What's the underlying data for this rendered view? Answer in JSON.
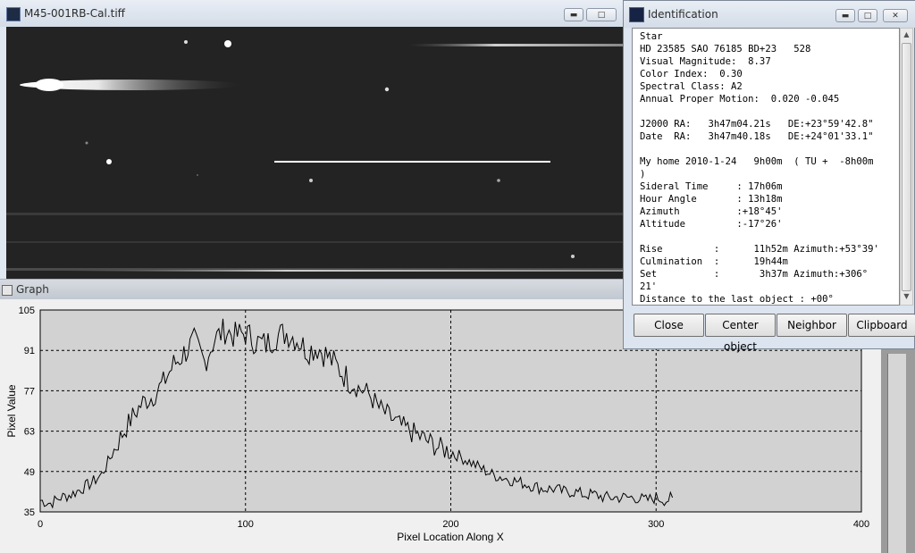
{
  "image_window": {
    "title": "M45-001RB-Cal.tiff",
    "controls": {
      "minimize_icon": "minimize-icon",
      "maximize_icon": "maximize-icon",
      "close_icon": "close-icon"
    }
  },
  "identification": {
    "title": "Identification",
    "lines": [
      "Star",
      "HD 23585 SAO 76185 BD+23   528",
      "Visual Magnitude:  8.37",
      "Color Index:  0.30",
      "Spectral Class: A2",
      "Annual Proper Motion:  0.020 -0.045",
      "",
      "J2000 RA:   3h47m04.21s   DE:+23°59'42.8\"",
      "Date  RA:   3h47m40.18s   DE:+24°01'33.1\"",
      "",
      "My home 2010-1-24   9h00m  ( TU +  -8h00m",
      ")",
      "Sideral Time     : 17h06m",
      "Hour Angle       : 13h18m",
      "Azimuth          :+18°45'",
      "Altitude         :-17°26'",
      "",
      "Rise         :      11h52m Azimuth:+53°39'",
      "Culmination  :      19h44m",
      "Set          :       3h37m Azimuth:+306°",
      "21'",
      "Distance to the last object : +00°"
    ],
    "buttons": {
      "close": "Close",
      "center_object": "Center object",
      "neighbor": "Neighbor",
      "clipboard": "Clipboard"
    }
  },
  "graph_window": {
    "title": "Graph",
    "chart_data": {
      "type": "line",
      "xlabel": "Pixel Location Along X",
      "ylabel": "Pixel Value",
      "xlim": [
        0,
        400
      ],
      "ylim": [
        35,
        105
      ],
      "x_ticks": [
        "0",
        "100",
        "200",
        "300",
        "400"
      ],
      "y_ticks": [
        "35",
        "49",
        "63",
        "77",
        "91",
        "105"
      ],
      "grid": true,
      "series": [
        {
          "color": "#000000",
          "x": [
            0,
            5,
            10,
            15,
            20,
            25,
            30,
            35,
            40,
            45,
            50,
            55,
            60,
            65,
            70,
            75,
            80,
            85,
            90,
            95,
            100,
            105,
            110,
            115,
            120,
            125,
            130,
            135,
            140,
            145,
            150,
            155,
            160,
            165,
            170,
            175,
            180,
            185,
            190,
            195,
            200,
            205,
            210,
            215,
            220,
            225,
            230,
            235,
            240,
            245,
            250,
            255,
            260,
            265,
            270,
            275,
            280,
            285,
            290,
            295,
            300,
            305,
            308
          ],
          "values": [
            39,
            38,
            40,
            41,
            43,
            45,
            48,
            55,
            62,
            68,
            73,
            75,
            80,
            86,
            90,
            94,
            87,
            95,
            98,
            96,
            97,
            94,
            93,
            96,
            97,
            95,
            91,
            92,
            89,
            85,
            81,
            78,
            76,
            71,
            68,
            65,
            63,
            61,
            59,
            57,
            56,
            54,
            52,
            50,
            48,
            47,
            46,
            45,
            44,
            43,
            43,
            42,
            42,
            41,
            41,
            40,
            40,
            40,
            40,
            39,
            40,
            39,
            40
          ]
        }
      ]
    }
  },
  "colors": {
    "window_frame": "#dfe7f1",
    "image_background": "#222222",
    "plot_background": "#d2d2d2",
    "trace": "#000000"
  }
}
